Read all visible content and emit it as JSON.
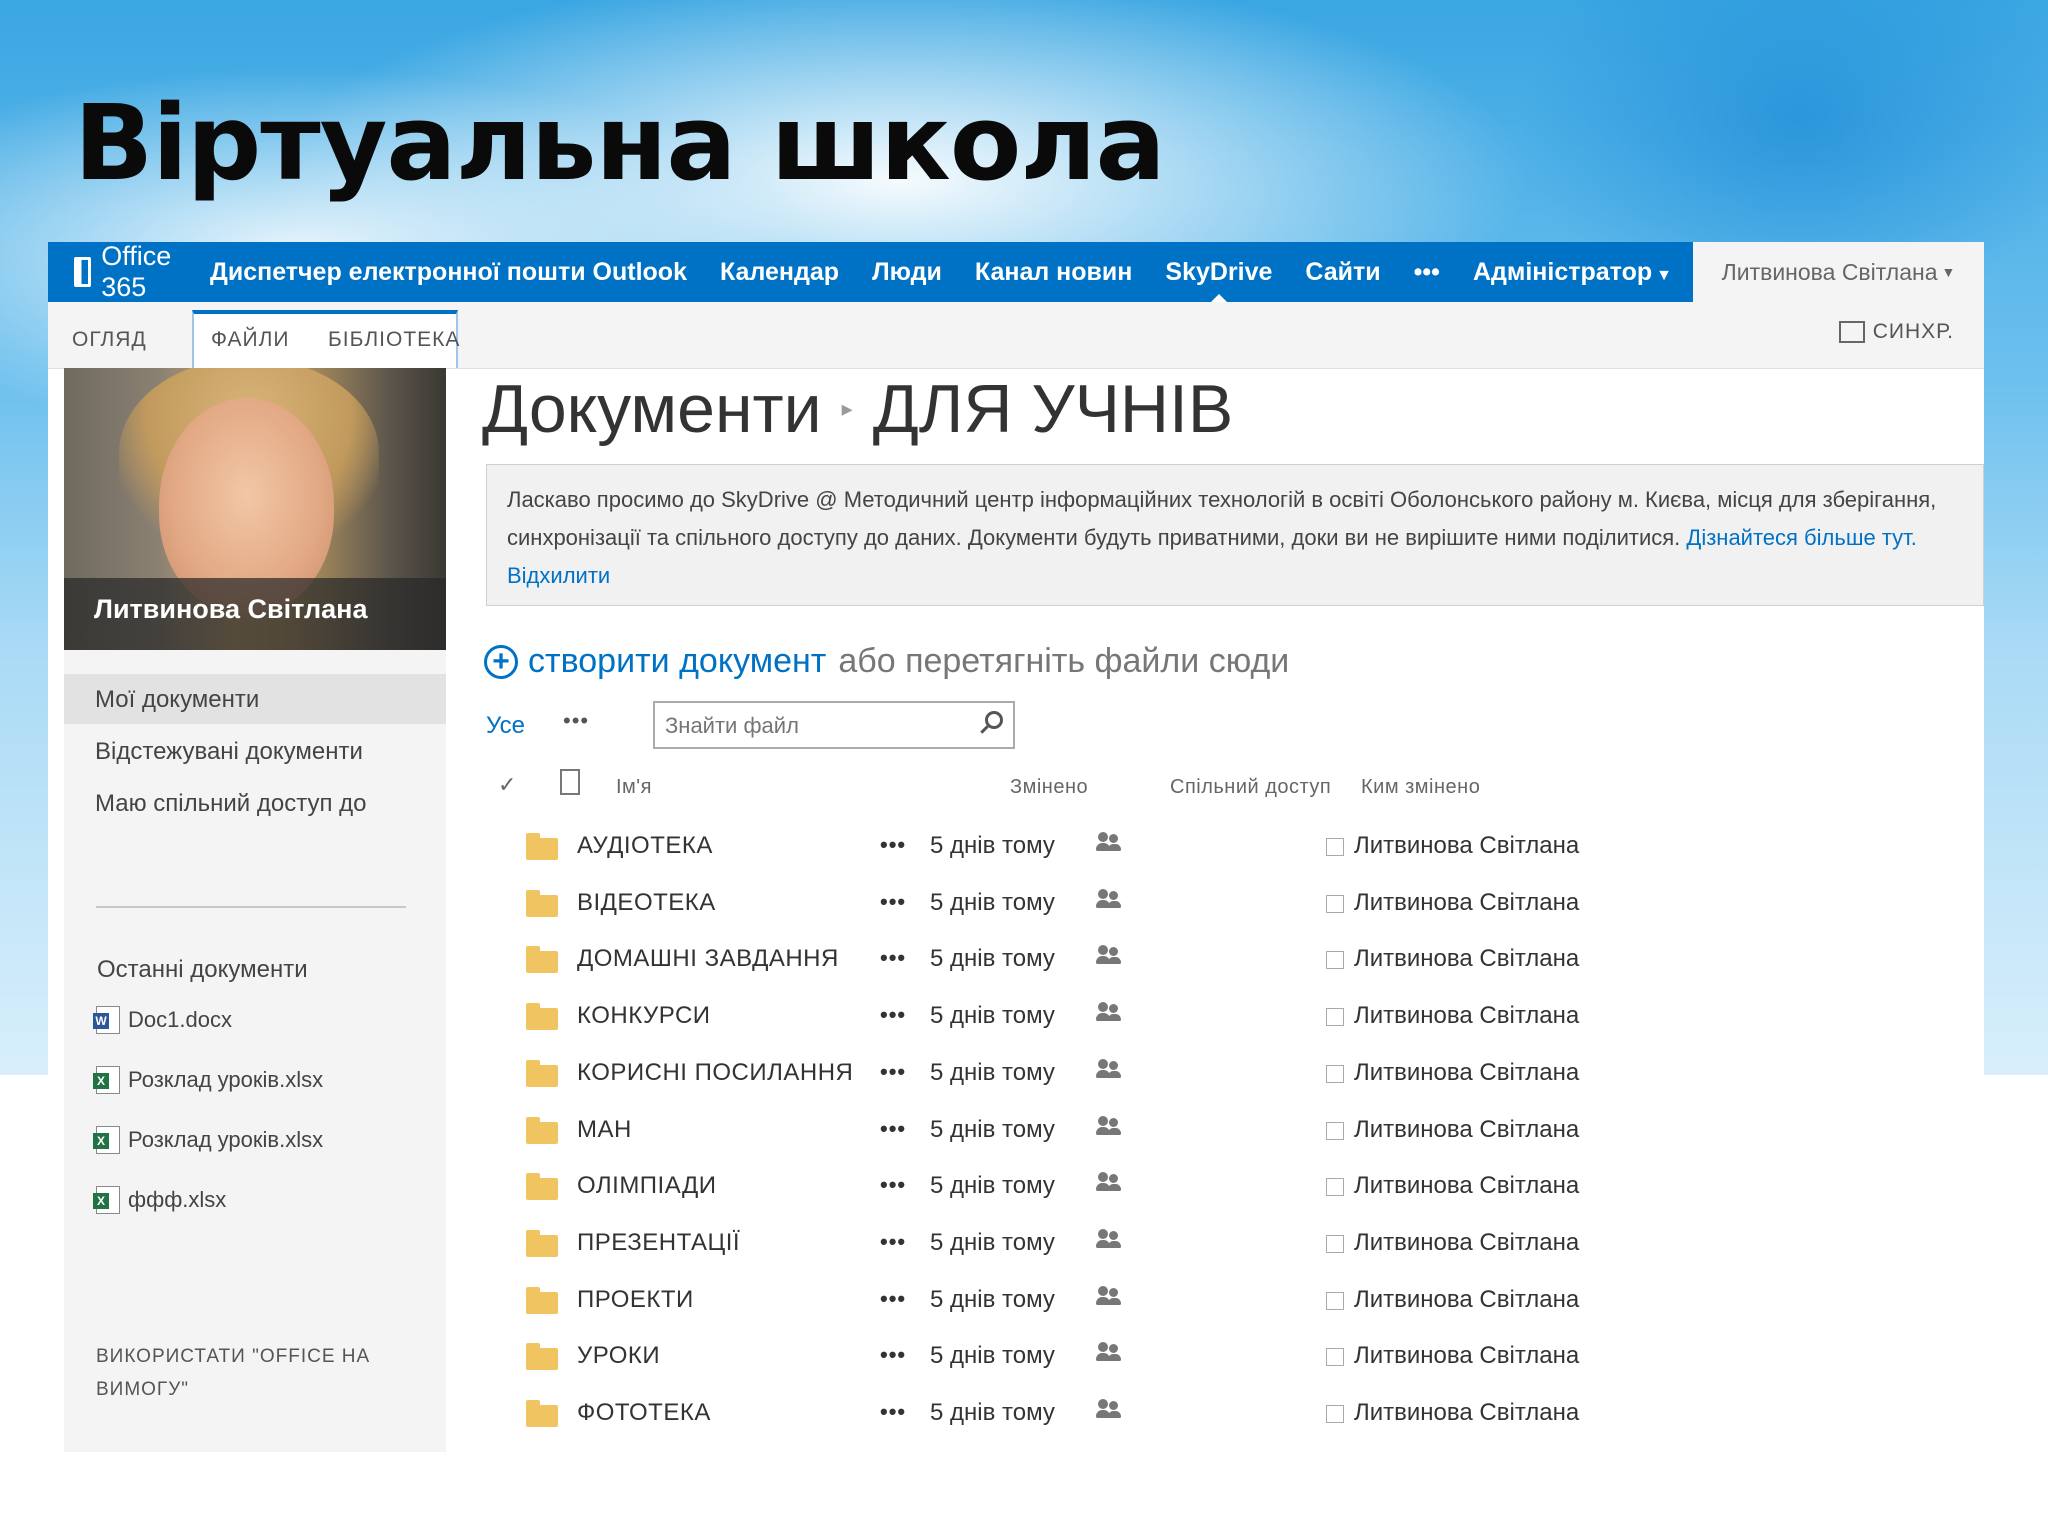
{
  "slide": {
    "title": "Віртуальна школа"
  },
  "suitebar": {
    "brand": "Office 365",
    "nav": [
      "Диспетчер електронної пошти Outlook",
      "Календар",
      "Люди",
      "Канал новин",
      "SkyDrive",
      "Сайти",
      "•••",
      "Адміністратор"
    ],
    "active": "SkyDrive",
    "user": "Литвинова Світлана"
  },
  "ribbon": {
    "tabs": [
      "ОГЛЯД",
      "ФАЙЛИ",
      "БІБЛІОТЕКА"
    ],
    "sync": "СИНХР."
  },
  "profile": {
    "name": "Литвинова Світлана"
  },
  "leftnav": {
    "items": [
      "Мої документи",
      "Відстежувані документи",
      "Маю спільний доступ до"
    ],
    "recent_heading": "Останні документи",
    "recent": [
      {
        "name": "Doc1.docx",
        "type": "word"
      },
      {
        "name": "Розклад уроків.xlsx",
        "type": "excel"
      },
      {
        "name": "Розклад уроків.xlsx",
        "type": "excel"
      },
      {
        "name": "ффф.xlsx",
        "type": "excel"
      }
    ],
    "office_on_demand": "ВИКОРИСТАТИ \"OFFICE НА ВИМОГУ\""
  },
  "breadcrumb": {
    "root": "Документи",
    "current": "ДЛЯ УЧНІВ"
  },
  "welcome": {
    "text": "Ласкаво просимо до SkyDrive @ Методичний центр інформаційних технологій в освіті Оболонського району м. Києва, місця для зберігання, синхронізації та спільного доступу до даних. Документи будуть приватними, доки ви не вирішите ними поділитися.",
    "learn_more": "Дізнайтеся більше тут.",
    "dismiss": "Відхилити"
  },
  "create": {
    "link": "створити документ",
    "rest": "або перетягніть файли сюди"
  },
  "filter": {
    "all": "Усе",
    "more": "•••",
    "search_placeholder": "Знайти файл"
  },
  "columns": {
    "name": "Ім'я",
    "modified": "Змінено",
    "sharing": "Спільний доступ",
    "modified_by": "Ким змінено"
  },
  "rows": [
    {
      "name": "АУДІОТЕКА",
      "modified": "5 днів тому",
      "by": "Литвинова Світлана"
    },
    {
      "name": "ВІДЕОТЕКА",
      "modified": "5 днів тому",
      "by": "Литвинова Світлана"
    },
    {
      "name": "ДОМАШНІ ЗАВДАННЯ",
      "modified": "5 днів тому",
      "by": "Литвинова Світлана"
    },
    {
      "name": "КОНКУРСИ",
      "modified": "5 днів тому",
      "by": "Литвинова Світлана"
    },
    {
      "name": "КОРИСНІ ПОСИЛАННЯ",
      "modified": "5 днів тому",
      "by": "Литвинова Світлана"
    },
    {
      "name": "МАН",
      "modified": "5 днів тому",
      "by": "Литвинова Світлана"
    },
    {
      "name": "ОЛІМПІАДИ",
      "modified": "5 днів тому",
      "by": "Литвинова Світлана"
    },
    {
      "name": "ПРЕЗЕНТАЦІЇ",
      "modified": "5 днів тому",
      "by": "Литвинова Світлана"
    },
    {
      "name": "ПРОЕКТИ",
      "modified": "5 днів тому",
      "by": "Литвинова Світлана"
    },
    {
      "name": "УРОКИ",
      "modified": "5 днів тому",
      "by": "Литвинова Світлана"
    },
    {
      "name": "ФОТОТЕКА",
      "modified": "5 днів тому",
      "by": "Литвинова Світлана"
    }
  ],
  "row_dots": "•••",
  "colors": {
    "accent": "#0072c6",
    "folder": "#f0c460"
  }
}
